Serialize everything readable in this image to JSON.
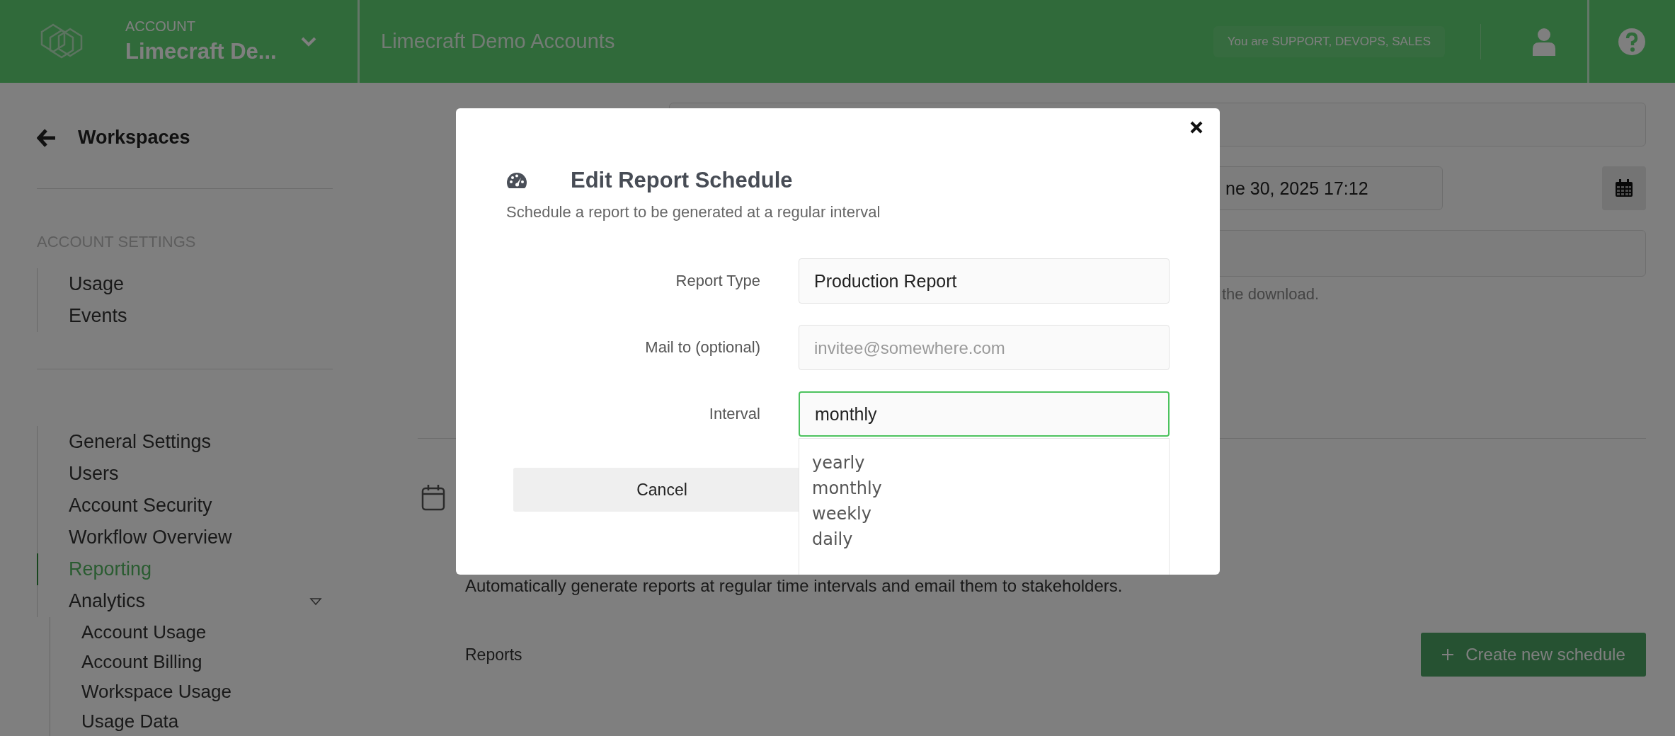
{
  "top_bar": {
    "account_label": "ACCOUNT",
    "account_name": "Limecraft De...",
    "page_title": "Limecraft Demo Accounts",
    "roles_badge": "You are SUPPORT, DEVOPS, SALES"
  },
  "sidebar": {
    "back_link": "Workspaces",
    "section_title": "ACCOUNT SETTINGS",
    "groups": [
      {
        "items": [
          {
            "label": "Usage",
            "selected": false
          },
          {
            "label": "Events",
            "selected": false
          }
        ]
      },
      {
        "items": [
          {
            "label": "General Settings",
            "selected": false
          },
          {
            "label": "Users",
            "selected": false
          },
          {
            "label": "Account Security",
            "selected": false
          },
          {
            "label": "Workflow Overview",
            "selected": false
          },
          {
            "label": "Reporting",
            "selected": true
          },
          {
            "label": "Analytics",
            "selected": false,
            "expanded": true,
            "children": [
              {
                "label": "Account Usage",
                "selected": false
              },
              {
                "label": "Account Billing",
                "selected": false
              },
              {
                "label": "Workspace Usage",
                "selected": false
              },
              {
                "label": "Usage Data",
                "selected": false
              }
            ]
          }
        ]
      }
    ]
  },
  "main": {
    "date_value": "ne 30, 2025 17:12",
    "download_hint": "the download.",
    "schedules": {
      "description": "Automatically generate reports at regular time intervals and email them to stakeholders.",
      "reports_label": "Reports",
      "create_button": "Create new schedule"
    }
  },
  "dialog": {
    "title": "Edit Report Schedule",
    "subtitle": "Schedule a report to be generated at a regular interval",
    "fields": [
      {
        "label": "Report Type",
        "value": "Production Report",
        "focused": false
      },
      {
        "label": "Mail to (optional)",
        "placeholder": "invitee@somewhere.com",
        "focused": false
      },
      {
        "label": "Interval",
        "value": "monthly",
        "focused": true
      }
    ],
    "interval_options": [
      "yearly",
      "monthly",
      "weekly",
      "daily"
    ],
    "cancel_button": "Cancel"
  }
}
